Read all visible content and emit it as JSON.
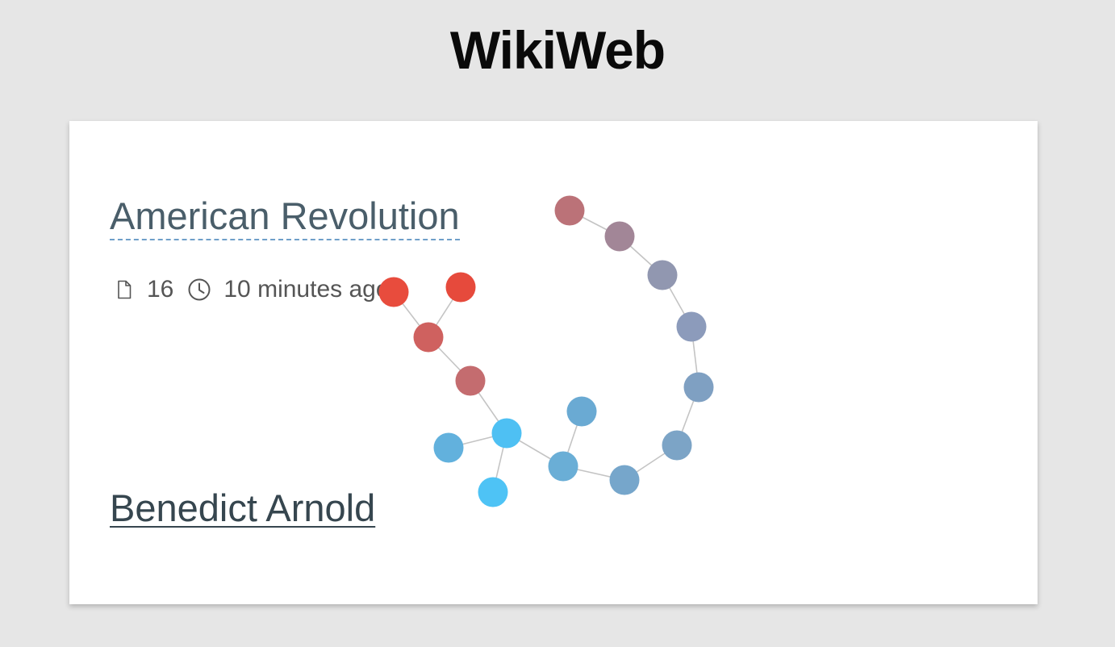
{
  "app": {
    "title": "WikiWeb"
  },
  "card": {
    "article_title": "American Revolution",
    "page_count": "16",
    "elapsed_time": "10 minutes ago",
    "link_label": "Benedict Arnold"
  },
  "icons": {
    "page": "file-icon",
    "clock": "clock-icon"
  },
  "colors": {
    "background": "#e6e6e6",
    "card": "#ffffff",
    "title_text": "#4a5e6a",
    "title_underline": "#6f9fc9",
    "link_text": "#36464f",
    "edge": "#c4c4c4"
  },
  "graph": {
    "nodes": [
      {
        "id": "n1",
        "color": "#e84c3d"
      },
      {
        "id": "n2",
        "color": "#e64a3c"
      },
      {
        "id": "n3",
        "color": "#cf615f"
      },
      {
        "id": "n4",
        "color": "#c46c6f"
      },
      {
        "id": "n5",
        "color": "#4ec0f3"
      },
      {
        "id": "n6",
        "color": "#62b1dd"
      },
      {
        "id": "n7",
        "color": "#4ec3f5"
      },
      {
        "id": "n8",
        "color": "#6aaed6"
      },
      {
        "id": "n9",
        "color": "#6aaad3"
      },
      {
        "id": "n10",
        "color": "#76a6cb"
      },
      {
        "id": "n11",
        "color": "#7ca4c6"
      },
      {
        "id": "n12",
        "color": "#7fa0c2"
      },
      {
        "id": "n13",
        "color": "#8c9bbb"
      },
      {
        "id": "n14",
        "color": "#9197b0"
      },
      {
        "id": "n15",
        "color": "#a28697"
      },
      {
        "id": "n16",
        "color": "#bb7278"
      }
    ],
    "edges": [
      [
        "n1",
        "n3"
      ],
      [
        "n2",
        "n3"
      ],
      [
        "n3",
        "n4"
      ],
      [
        "n4",
        "n5"
      ],
      [
        "n5",
        "n6"
      ],
      [
        "n5",
        "n7"
      ],
      [
        "n5",
        "n8"
      ],
      [
        "n8",
        "n9"
      ],
      [
        "n8",
        "n10"
      ],
      [
        "n10",
        "n11"
      ],
      [
        "n11",
        "n12"
      ],
      [
        "n12",
        "n13"
      ],
      [
        "n13",
        "n14"
      ],
      [
        "n14",
        "n15"
      ],
      [
        "n15",
        "n16"
      ]
    ]
  }
}
